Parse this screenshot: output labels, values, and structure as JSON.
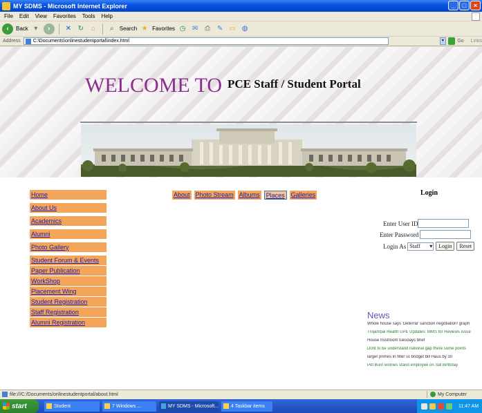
{
  "window": {
    "title": "MY SDMS - Microsoft Internet Explorer",
    "controls": {
      "minimize": "_",
      "maximize": "□",
      "close": "×"
    }
  },
  "menubar": {
    "items": [
      "File",
      "Edit",
      "View",
      "Favorites",
      "Tools",
      "Help"
    ]
  },
  "toolbar": {
    "back_label": "Back",
    "search_label": "Search",
    "favorites_label": "Favorites"
  },
  "addressbar": {
    "label": "Address",
    "url": "C:\\Documents\\onlinestudentportal\\index.html",
    "go_label": "Go",
    "links_label": "Links"
  },
  "banner": {
    "welcome": "WELCOME TO",
    "portal_title": "PCE Staff / Student Portal"
  },
  "left_menu": {
    "items": [
      "Home",
      "About Us",
      "Academics",
      "Alumni",
      "Photo Gallery",
      "Student Forum & Events",
      "Paper Publication",
      "WorkShop",
      "Placement Wing",
      "Student Registration",
      "Staff Registration",
      "Alumni Registration"
    ]
  },
  "top_nav": {
    "items": [
      "About",
      "Photo Stream",
      "Albums",
      "Places",
      "Galleries"
    ]
  },
  "login": {
    "title": "Login",
    "user_id_label": "Enter User ID",
    "password_label": "Enter Password",
    "login_as_label": "Login As",
    "login_as_value": "Staff",
    "login_button": "Login",
    "reset_button": "Reset"
  },
  "news": {
    "title": "News",
    "lines": [
      {
        "text": "Whole house says 'Deferral' sanction negotiation! graph",
        "color": "#333333"
      },
      {
        "text": "Trojan/pal Health UPE Updates: MMS for Reviews Issue",
        "color": "#2f7a2f"
      },
      {
        "text": "House trustroom tuesdays brief",
        "color": "#333333"
      },
      {
        "text": "Dont to be understand national gap there some points",
        "color": "#2f7a2f"
      },
      {
        "text": "larger primes in filter ss bridget bill Haus by 30",
        "color": "#333333"
      },
      {
        "text": "Pet Burn worries stand employee on Sat Birthday",
        "color": "#2f7a2f"
      }
    ]
  },
  "statusbar": {
    "text": "file:///C:/Documents/onlinestudentportal/about.html",
    "zone": "My Computer"
  },
  "taskbar": {
    "start_label": "start",
    "tasks": [
      {
        "label": "Student",
        "active": false
      },
      {
        "label": "7 Windows ...",
        "active": false
      },
      {
        "label": "MY SDMS - Microsoft...",
        "active": true
      },
      {
        "label": "4 Taskbar items",
        "active": false
      }
    ],
    "clock": "11:47 AM"
  },
  "colors": {
    "menu_orange": "#f3a55a",
    "link_blue": "#1a1ab4",
    "welcome_purple": "#8e2d90",
    "news_blue": "#5d58b8"
  }
}
